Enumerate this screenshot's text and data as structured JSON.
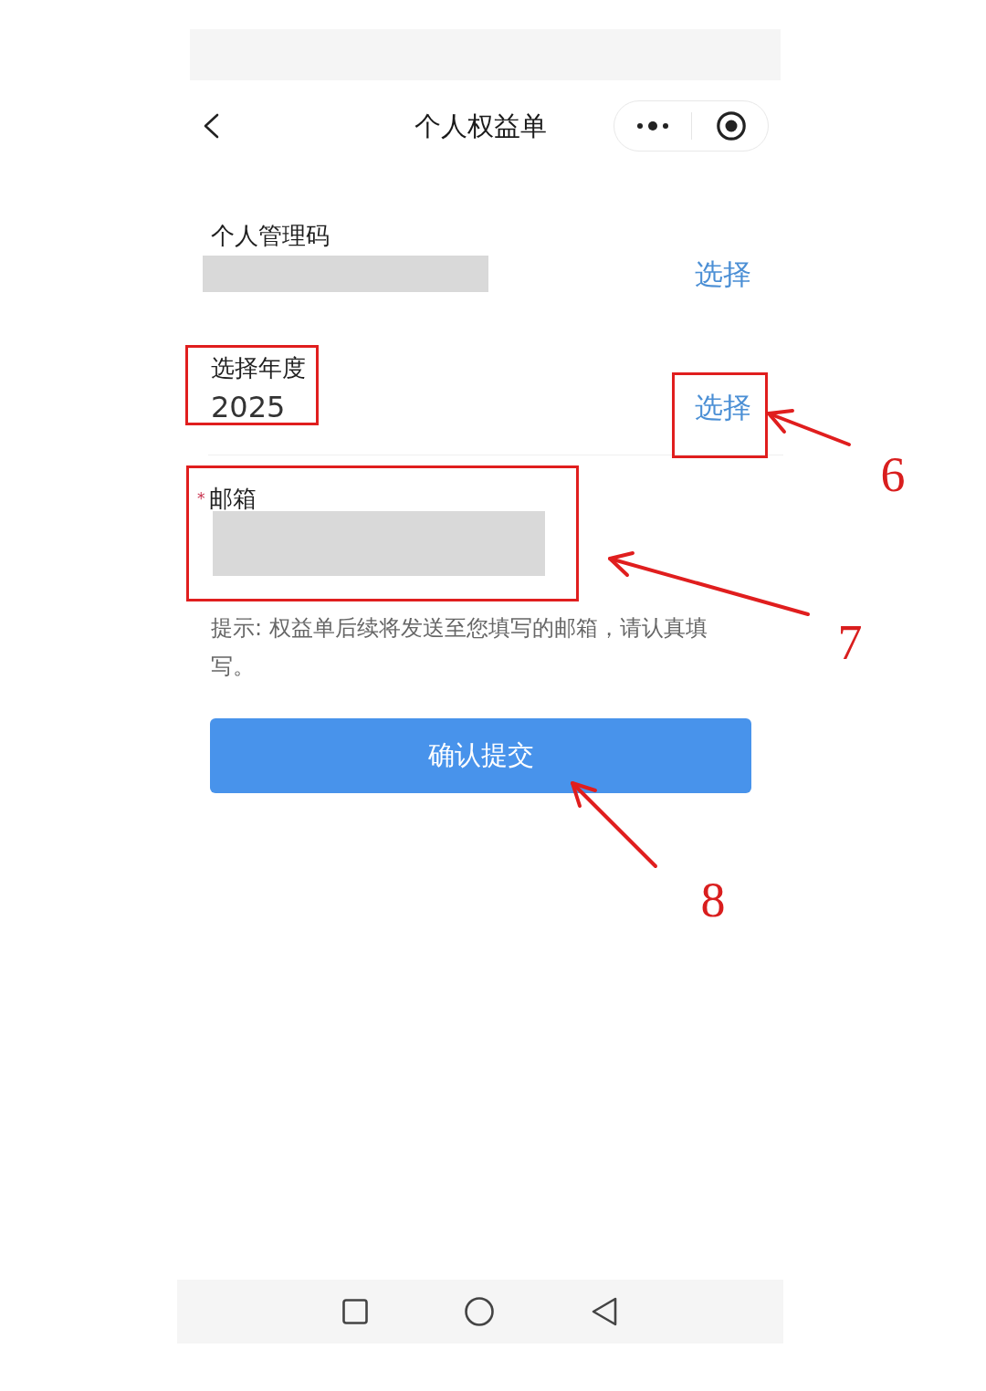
{
  "nav": {
    "title": "个人权益单"
  },
  "form": {
    "fields": [
      {
        "kind": "picker",
        "label": "个人管理码",
        "redacted": true,
        "action": "选择",
        "highlighted": false,
        "action_highlighted": false
      },
      {
        "kind": "picker",
        "label": "选择年度",
        "value": "2025",
        "redacted": false,
        "action": "选择",
        "highlighted": true,
        "action_highlighted": true
      },
      {
        "kind": "input",
        "label": "邮箱",
        "required_mark": "*",
        "redacted": true,
        "highlighted": true
      }
    ],
    "hint": "提示: 权益单后续将发送至您填写的邮箱，请认真填写。",
    "submit_button": "确认提交"
  },
  "callouts": [
    {
      "number": "6"
    },
    {
      "number": "7"
    },
    {
      "number": "8"
    }
  ]
}
